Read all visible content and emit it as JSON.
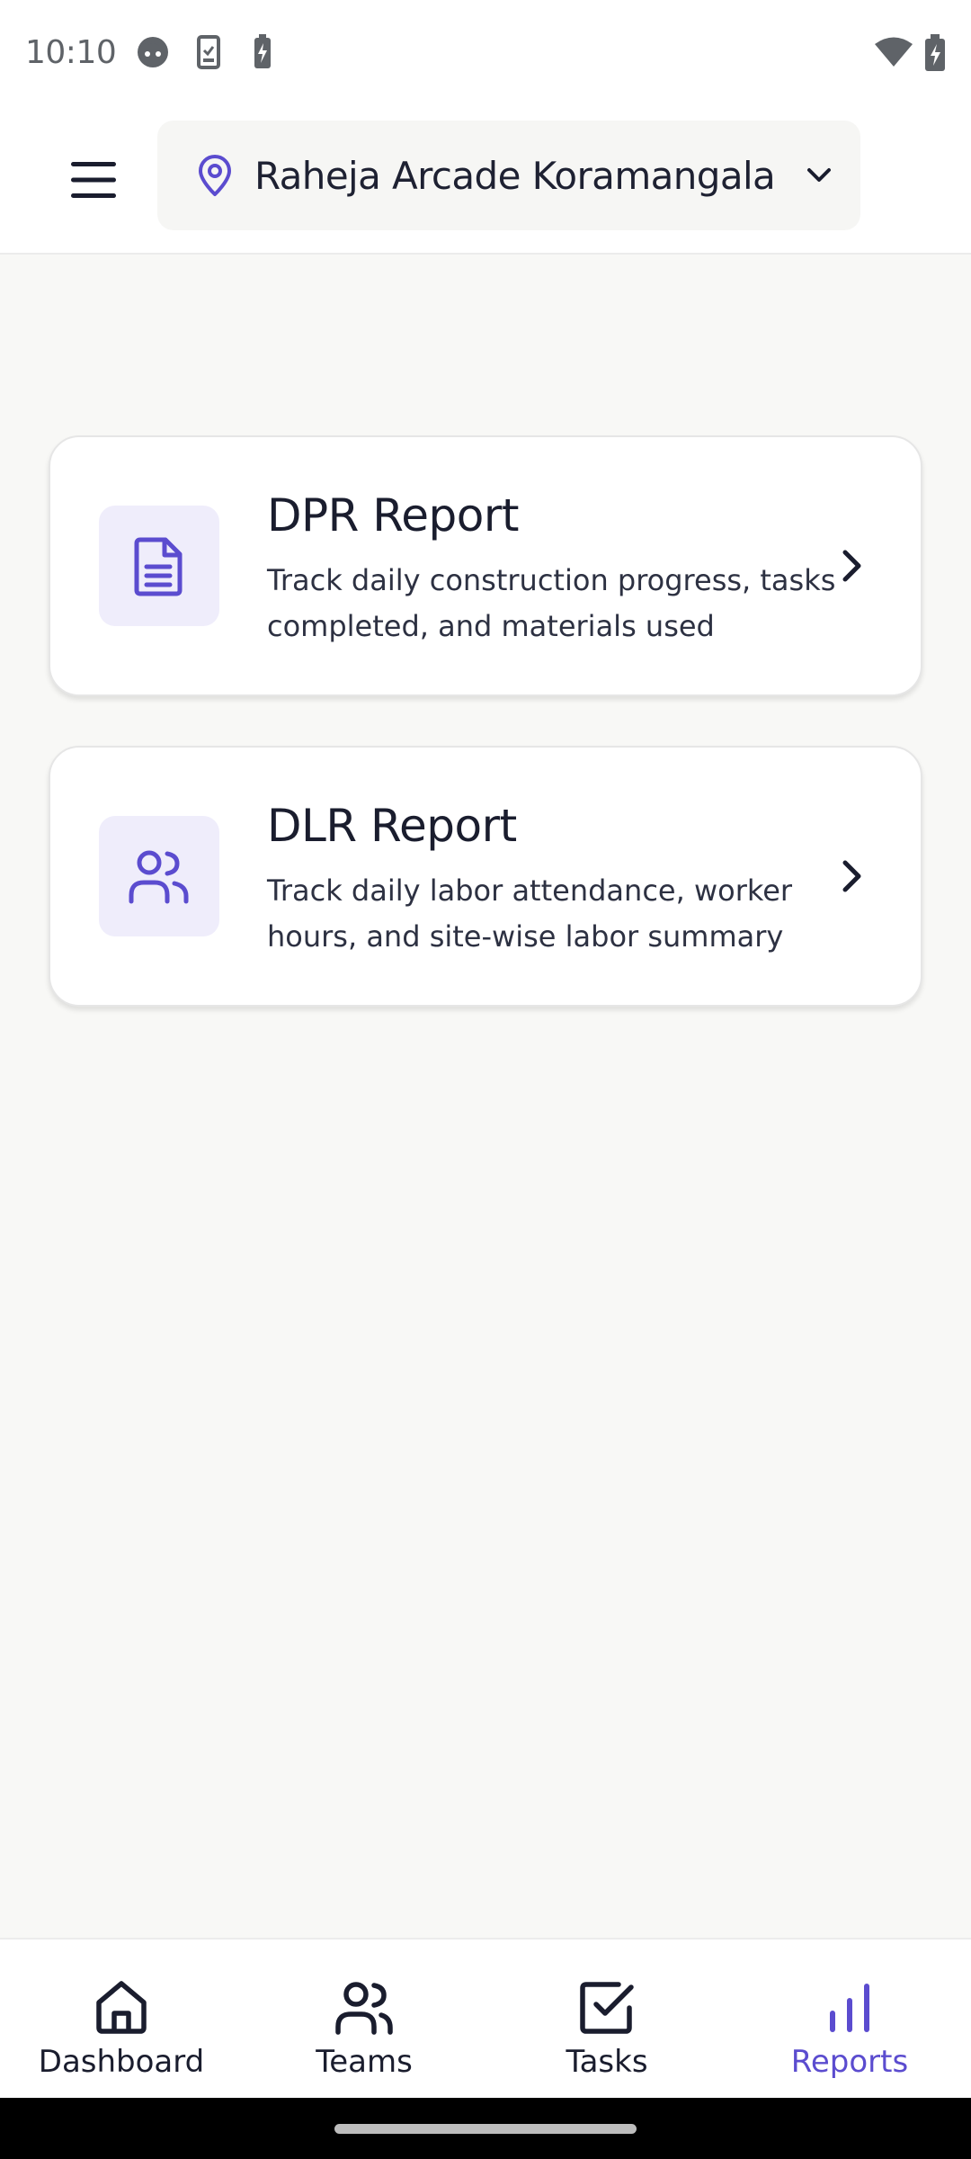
{
  "status_bar": {
    "time": "10:10"
  },
  "header": {
    "menu_icon": "hamburger-menu-icon",
    "location": {
      "icon": "map-pin-icon",
      "name": "Raheja Arcade Koramangala",
      "chevron": "chevron-down-icon"
    }
  },
  "reports": [
    {
      "icon": "document-icon",
      "title": "DPR Report",
      "description": "Track daily construction progress, tasks completed, and materials used"
    },
    {
      "icon": "users-icon",
      "title": "DLR Report",
      "description": "Track daily labor attendance, worker hours, and site-wise labor summary"
    }
  ],
  "bottom_nav": {
    "items": [
      {
        "label": "Dashboard",
        "icon": "home-icon",
        "active": false
      },
      {
        "label": "Teams",
        "icon": "users-icon",
        "active": false
      },
      {
        "label": "Tasks",
        "icon": "checkbox-icon",
        "active": false
      },
      {
        "label": "Reports",
        "icon": "bar-chart-icon",
        "active": true
      }
    ]
  },
  "colors": {
    "accent": "#5b4ccf",
    "icon_tile": "#efedfb",
    "background": "#f8f8f6",
    "text": "#1a1d2e"
  }
}
